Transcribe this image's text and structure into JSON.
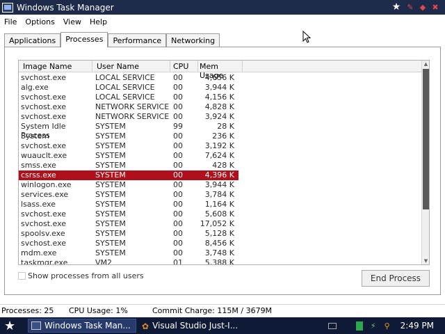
{
  "window": {
    "title": "Windows Task Manager",
    "title_controls": [
      "★",
      "✎",
      "◆",
      "✖"
    ]
  },
  "menu": [
    "File",
    "Options",
    "View",
    "Help"
  ],
  "tabs": [
    "Applications",
    "Processes",
    "Performance",
    "Networking"
  ],
  "active_tab": "Processes",
  "columns": [
    "Image Name",
    "User Name",
    "CPU",
    "Mem Usage"
  ],
  "rows": [
    {
      "name": "svchost.exe",
      "user": "LOCAL SERVICE",
      "cpu": "00",
      "mem": "4,656 K"
    },
    {
      "name": "alg.exe",
      "user": "LOCAL SERVICE",
      "cpu": "00",
      "mem": "3,944 K"
    },
    {
      "name": "svchost.exe",
      "user": "LOCAL SERVICE",
      "cpu": "00",
      "mem": "4,156 K"
    },
    {
      "name": "svchost.exe",
      "user": "NETWORK SERVICE",
      "cpu": "00",
      "mem": "4,828 K"
    },
    {
      "name": "svchost.exe",
      "user": "NETWORK SERVICE",
      "cpu": "00",
      "mem": "3,924 K"
    },
    {
      "name": "System Idle Process",
      "user": "SYSTEM",
      "cpu": "99",
      "mem": "28 K"
    },
    {
      "name": "System",
      "user": "SYSTEM",
      "cpu": "00",
      "mem": "236 K"
    },
    {
      "name": "svchost.exe",
      "user": "SYSTEM",
      "cpu": "00",
      "mem": "3,192 K"
    },
    {
      "name": "wuauclt.exe",
      "user": "SYSTEM",
      "cpu": "00",
      "mem": "7,624 K"
    },
    {
      "name": "smss.exe",
      "user": "SYSTEM",
      "cpu": "00",
      "mem": "428 K"
    },
    {
      "name": "csrss.exe",
      "user": "SYSTEM",
      "cpu": "00",
      "mem": "4,396 K",
      "selected": true
    },
    {
      "name": "winlogon.exe",
      "user": "SYSTEM",
      "cpu": "00",
      "mem": "3,944 K"
    },
    {
      "name": "services.exe",
      "user": "SYSTEM",
      "cpu": "00",
      "mem": "3,784 K"
    },
    {
      "name": "lsass.exe",
      "user": "SYSTEM",
      "cpu": "00",
      "mem": "1,164 K"
    },
    {
      "name": "svchost.exe",
      "user": "SYSTEM",
      "cpu": "00",
      "mem": "5,608 K"
    },
    {
      "name": "svchost.exe",
      "user": "SYSTEM",
      "cpu": "00",
      "mem": "17,052 K"
    },
    {
      "name": "spoolsv.exe",
      "user": "SYSTEM",
      "cpu": "00",
      "mem": "5,128 K"
    },
    {
      "name": "svchost.exe",
      "user": "SYSTEM",
      "cpu": "00",
      "mem": "8,456 K"
    },
    {
      "name": "mdm.exe",
      "user": "SYSTEM",
      "cpu": "00",
      "mem": "3,748 K"
    },
    {
      "name": "taskmgr.exe",
      "user": "VM2",
      "cpu": "01",
      "mem": "5,388 K"
    }
  ],
  "show_all_label": "Show processes from all users",
  "end_process_label": "End Process",
  "status": {
    "processes": "Processes: 25",
    "cpu": "CPU Usage: 1%",
    "commit": "Commit Charge: 115M / 3679M"
  },
  "taskbar": {
    "items": [
      "Windows Task Man...",
      "Visual Studio Just-I..."
    ],
    "clock": "2:49 PM"
  },
  "colors": {
    "titlebar": "#1e2a4a",
    "selection": "#b0101c",
    "taskbar": "#0f1a36"
  }
}
